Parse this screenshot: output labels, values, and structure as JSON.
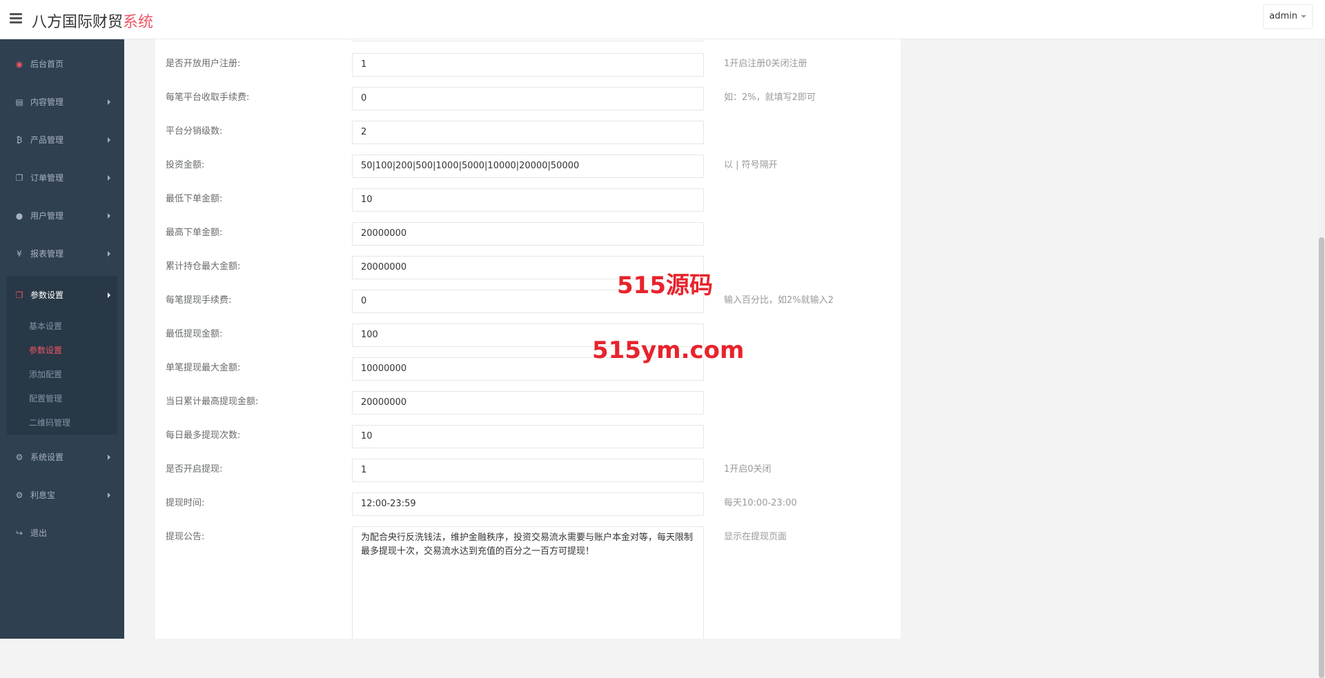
{
  "app": {
    "brand_main": "八方国际财贸",
    "brand_accent": "系统",
    "user_menu": "admin"
  },
  "colors": {
    "sidebar_bg": "#2f4050",
    "accent": "#ed5565",
    "watermark": "#e8232c"
  },
  "sidebar": {
    "items": [
      {
        "label": "后台首页",
        "icon": "dashboard-icon"
      },
      {
        "label": "内容管理",
        "icon": "book-icon"
      },
      {
        "label": "产品管理",
        "icon": "bitcoin-icon"
      },
      {
        "label": "订单管理",
        "icon": "copy-icon"
      },
      {
        "label": "用户管理",
        "icon": "user-icon"
      },
      {
        "label": "报表管理",
        "icon": "yen-icon"
      },
      {
        "label": "参数设置",
        "icon": "files-icon"
      },
      {
        "label": "系统设置",
        "icon": "gears-icon"
      },
      {
        "label": "利息宝",
        "icon": "gears-icon"
      },
      {
        "label": "退出",
        "icon": "sign-out-icon"
      }
    ],
    "sub_items": [
      {
        "label": "基本设置"
      },
      {
        "label": "参数设置"
      },
      {
        "label": "添加配置"
      },
      {
        "label": "配置管理"
      },
      {
        "label": "二维码管理"
      }
    ]
  },
  "form": {
    "rows": [
      {
        "label": "是否开放用户注册:",
        "value": "1",
        "hint": "1开启注册0关闭注册"
      },
      {
        "label": "每笔平台收取手续费:",
        "value": "0",
        "hint": "如：2%，就填写2即可"
      },
      {
        "label": "平台分销级数:",
        "value": "2",
        "hint": ""
      },
      {
        "label": "投资金额:",
        "value": "50|100|200|500|1000|5000|10000|20000|50000",
        "hint": "以 | 符号隔开"
      },
      {
        "label": "最低下单金额:",
        "value": "10",
        "hint": ""
      },
      {
        "label": "最高下单金额:",
        "value": "20000000",
        "hint": ""
      },
      {
        "label": "累计持仓最大金额:",
        "value": "20000000",
        "hint": ""
      },
      {
        "label": "每笔提现手续费:",
        "value": "0",
        "hint": "输入百分比，如2%就输入2"
      },
      {
        "label": "最低提现金额:",
        "value": "100",
        "hint": ""
      },
      {
        "label": "单笔提现最大金额:",
        "value": "10000000",
        "hint": ""
      },
      {
        "label": "当日累计最高提现金额:",
        "value": "20000000",
        "hint": ""
      },
      {
        "label": "每日最多提现次数:",
        "value": "10",
        "hint": ""
      },
      {
        "label": "是否开启提现:",
        "value": "1",
        "hint": "1开启0关闭"
      },
      {
        "label": "提现时间:",
        "value": "12:00-23:59",
        "hint": "每天10:00-23:00"
      }
    ],
    "notice": {
      "label": "提现公告:",
      "value": "为配合央行反洗钱法，维护金融秩序，投资交易流水需要与账户本金对等，每天限制最多提现十次，交易流水达到充值的百分之一百方可提现！",
      "hint": "显示在提现页面"
    }
  },
  "watermarks": {
    "line1": "515源码",
    "line2": "515ym.com"
  }
}
